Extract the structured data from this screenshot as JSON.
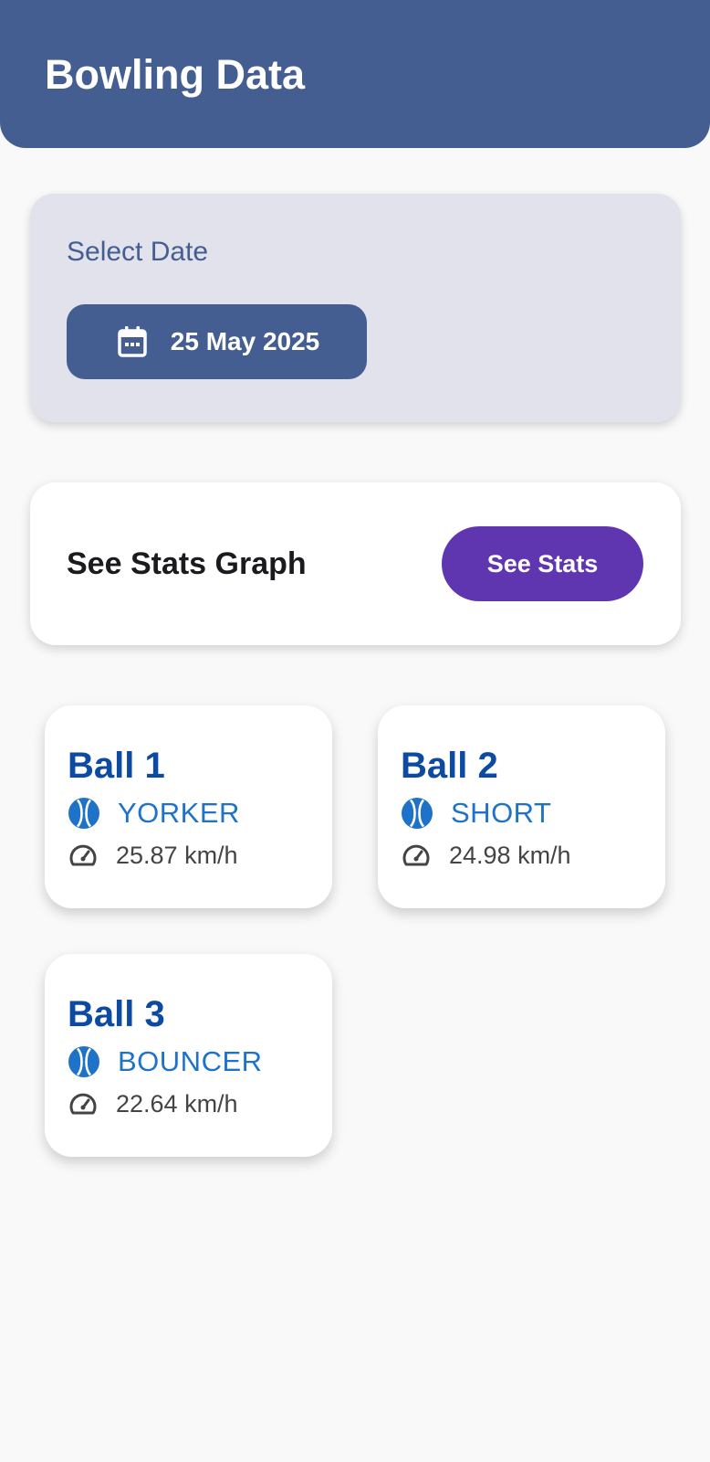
{
  "app_bar": {
    "title": "Bowling Data",
    "color": "#455e91"
  },
  "date_section": {
    "label": "Select Date",
    "selected_date": "25 May 2025",
    "icon": "calendar-icon"
  },
  "stats_section": {
    "label": "See Stats Graph",
    "button_label": "See Stats",
    "button_color": "#6036b0"
  },
  "balls": [
    {
      "title": "Ball 1",
      "type": "YORKER",
      "speed": "25.87 km/h"
    },
    {
      "title": "Ball 2",
      "type": "SHORT",
      "speed": "24.98 km/h"
    },
    {
      "title": "Ball 3",
      "type": "BOUNCER",
      "speed": "22.64 km/h"
    }
  ],
  "icons": {
    "ball": "cricket-ball-icon",
    "speed": "speedometer-icon"
  },
  "colors": {
    "ball_title": "#0d4aa1",
    "ball_type": "#1e73c9",
    "background": "#f9f9f9"
  }
}
